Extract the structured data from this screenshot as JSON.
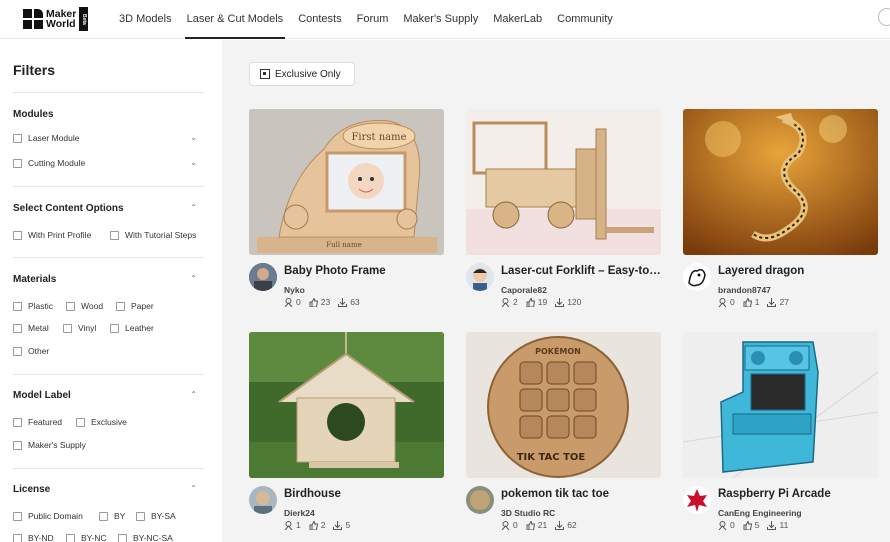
{
  "logo": {
    "line1": "Maker",
    "line2": "World",
    "badge": "Beta"
  },
  "nav": [
    "3D Models",
    "Laser & Cut Models",
    "Contests",
    "Forum",
    "Maker's Supply",
    "MakerLab",
    "Community"
  ],
  "sidebar": {
    "title": "Filters",
    "modules": {
      "title": "Modules",
      "items": [
        "Laser Module",
        "Cutting Module"
      ]
    },
    "content": {
      "title": "Select Content Options",
      "items": [
        "With Print Profile",
        "With Tutorial Steps"
      ]
    },
    "materials": {
      "title": "Materials",
      "items": [
        "Plastic",
        "Wood",
        "Paper",
        "Metal",
        "Vinyl",
        "Leather",
        "Other"
      ]
    },
    "label": {
      "title": "Model Label",
      "items": [
        "Featured",
        "Exclusive",
        "Maker's Supply"
      ]
    },
    "license": {
      "title": "License",
      "items": [
        "Public Domain",
        "BY",
        "BY-SA",
        "BY-ND",
        "BY-NC",
        "BY-NC-SA"
      ]
    }
  },
  "main": {
    "exclusive_label": "Exclusive Only",
    "cards": [
      {
        "title": "Baby Photo Frame",
        "author": "Nyko",
        "downloads_icon": "download-icon",
        "stats": [
          "0",
          "23",
          "63"
        ],
        "photo_text": "First name",
        "photo_sub": "Full name"
      },
      {
        "title": "Laser-cut Forklift – Easy-to-…",
        "author": "Caporale82",
        "stats": [
          "2",
          "19",
          "120"
        ]
      },
      {
        "title": "Layered dragon",
        "author": "brandon8747",
        "stats": [
          "0",
          "1",
          "27"
        ]
      },
      {
        "title": "Birdhouse",
        "author": "Dierk24",
        "stats": [
          "1",
          "2",
          "5"
        ]
      },
      {
        "title": "pokemon tik tac toe",
        "author": "3D Studio RC",
        "stats": [
          "0",
          "21",
          "62"
        ],
        "photo_text": "TIK TAC TOE",
        "photo_top": "POKÉMON"
      },
      {
        "title": "Raspberry Pi Arcade",
        "author": "CanEng Engineering",
        "stats": [
          "0",
          "5",
          "11"
        ]
      }
    ]
  },
  "colors": {
    "main_bg": "#f3f3f3",
    "accent": "#222222"
  }
}
